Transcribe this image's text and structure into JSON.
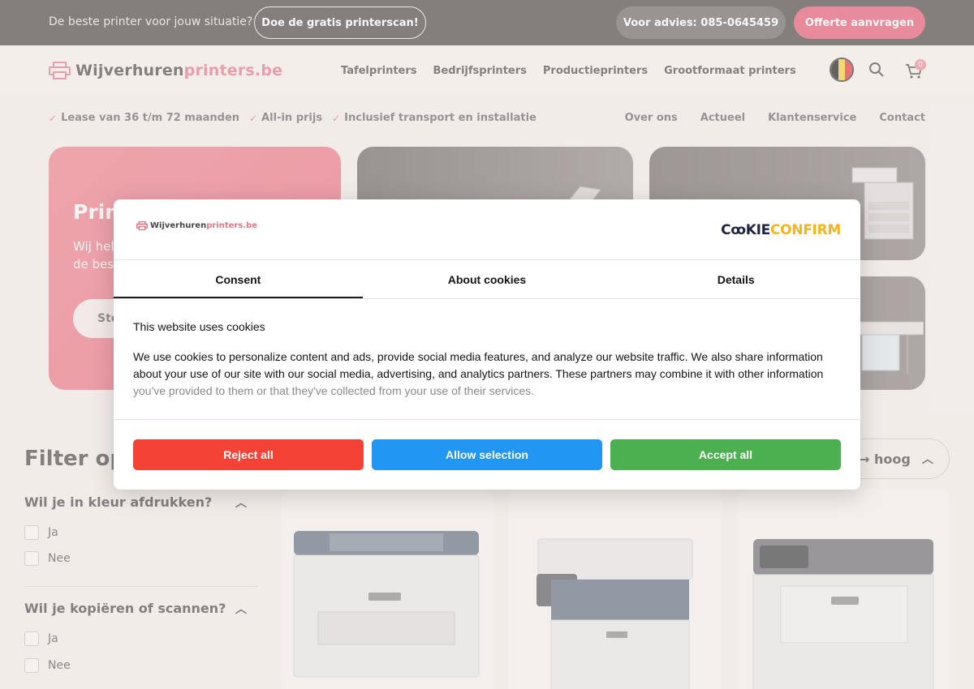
{
  "topbar": {
    "tagline": "De beste printer voor jouw situatie?",
    "scan_button": "Doe de gratis printerscan!",
    "phone_button": "Voor advies: 085-0645459",
    "quote_button": "Offerte aanvragen"
  },
  "header": {
    "logo_main": "Wijverhuren",
    "logo_accent": "printers.be",
    "nav": [
      "Tafelprinters",
      "Bedrijfsprinters",
      "Productieprinters",
      "Grootformaat printers"
    ],
    "cart_count": "0",
    "flag_colors": [
      "#1a1a1a",
      "#f7d034",
      "#e2343c"
    ]
  },
  "usps": [
    "Lease van 36 t/m 72 maanden",
    "All-in prijs",
    "Inclusief transport en installatie"
  ],
  "subnav": [
    "Over ons",
    "Actueel",
    "Klantenservice",
    "Contact"
  ],
  "hero": {
    "title": "Prin",
    "subtitle_line1": "Wij hel",
    "subtitle_line2": "de bes",
    "button": "Sto"
  },
  "filters": {
    "title": "Filter op:",
    "groups": [
      {
        "question": "Wil je in kleur afdrukken?",
        "options": [
          "Ja",
          "Nee"
        ]
      },
      {
        "question": "Wil je kopiëren of scannen?",
        "options": [
          "Ja",
          "Nee"
        ]
      }
    ]
  },
  "sort": {
    "label": "g → hoog"
  },
  "cookie": {
    "site_logo_main": "Wijverhuren",
    "site_logo_accent": "printers.be",
    "brand_dark1": "C",
    "brand_dark2": "KIE",
    "brand_yellow": "CONFIRM",
    "tabs": [
      "Consent",
      "About cookies",
      "Details"
    ],
    "heading": "This website uses cookies",
    "body_main": "We use cookies to personalize content and ads, provide social media features, and analyze our website traffic. We also share information about your use of our site with our social media, advertising, and analytics partners. These partners may combine it with other information",
    "body_fade": "you've provided to them or that they've collected from your use of their services.",
    "reject": "Reject all",
    "allow": "Allow selection",
    "accept": "Accept all"
  },
  "colors": {
    "brand_pink": "#e25a75",
    "reject": "#f44336",
    "allow": "#2196f3",
    "accept": "#4caf50"
  }
}
